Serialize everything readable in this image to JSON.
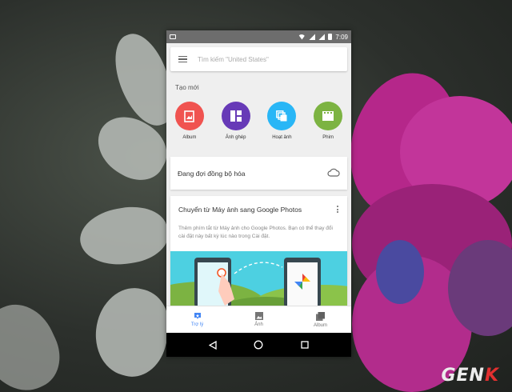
{
  "statusbar": {
    "time": "7:09"
  },
  "search": {
    "placeholder": "Tìm kiếm \"United States\""
  },
  "create": {
    "title": "Tạo mới",
    "items": [
      {
        "label": "Album",
        "color": "#f05350",
        "icon": "album-icon"
      },
      {
        "label": "Ảnh ghép",
        "color": "#673ab7",
        "icon": "collage-icon"
      },
      {
        "label": "Hoạt ảnh",
        "color": "#29b6f6",
        "icon": "animation-icon"
      },
      {
        "label": "Phim",
        "color": "#7cb342",
        "icon": "movie-icon"
      }
    ]
  },
  "sync": {
    "text": "Đang đợi đồng bộ hóa",
    "icon": "cloud-icon"
  },
  "info_card": {
    "title": "Chuyển từ Máy ảnh sang Google Photos",
    "body": "Thêm phím tắt từ Máy ảnh cho Google Photos. Bạn có thể thay đổi cài đặt này bất kỳ lúc nào trong Cài đặt."
  },
  "bottom_nav": [
    {
      "label": "Trợ lý",
      "icon": "assistant-icon",
      "active": true
    },
    {
      "label": "Ảnh",
      "icon": "photo-icon",
      "active": false
    },
    {
      "label": "Album",
      "icon": "album-stack-icon",
      "active": false
    }
  ],
  "watermark": {
    "text": "GEN",
    "accent": "K"
  },
  "colors": {
    "accent": "#4285f4",
    "status_bar": "#6d6d6d"
  }
}
